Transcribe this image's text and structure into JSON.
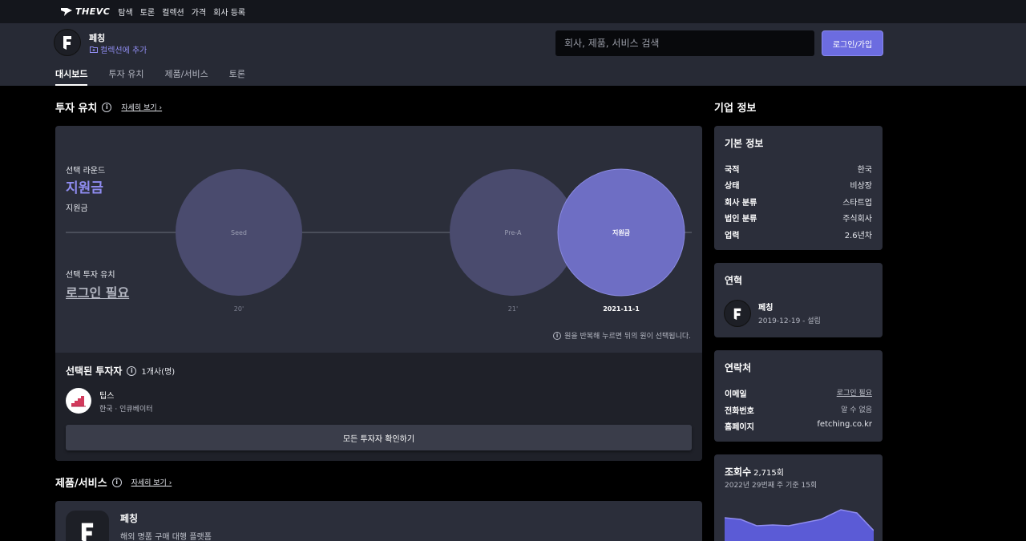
{
  "topnav": {
    "brand": "THEVC",
    "links": [
      "탐색",
      "토론",
      "컬렉션",
      "가격",
      "회사 등록"
    ]
  },
  "company": {
    "name": "페칭",
    "collection_label": "컬렉션에 추가",
    "search_placeholder": "회사, 제품, 서비스 검색",
    "login_label": "로그인/가입",
    "tabs": [
      "대시보드",
      "투자 유치",
      "제품/서비스",
      "토론"
    ],
    "active_tab": "대시보드"
  },
  "investment": {
    "title": "투자 유치",
    "more_label": "자세히 보기",
    "selected_round_label": "선택 라운드",
    "selected_round_name": "지원금",
    "selected_round_sub": "지원금",
    "selected_investment_label": "선택 투자 유치",
    "login_required": "로그인 필요",
    "hint": "원을 반복해 누르면 뒤의 원이 선택됩니다.",
    "rounds": [
      {
        "label": "Seed",
        "date": "20'",
        "selected": false
      },
      {
        "label": "Pre-A",
        "date": "21'",
        "selected": false
      },
      {
        "label": "지원금",
        "date": "2021-11-1",
        "selected": true
      }
    ],
    "selected_investors_title": "선택된 투자자",
    "selected_investors_count": "1개사(명)",
    "investors": [
      {
        "name": "팁스",
        "desc": "한국 · 인큐베이터"
      }
    ],
    "all_investors_button": "모든 투자자 확인하기"
  },
  "products": {
    "title": "제품/서비스",
    "more_label": "자세히 보기",
    "items": [
      {
        "name": "페칭",
        "desc": "해외 명품 구매 대행 플랫폼"
      }
    ]
  },
  "side": {
    "title": "기업 정보",
    "basic": {
      "title": "기본 정보",
      "rows": [
        {
          "k": "국적",
          "v": "한국"
        },
        {
          "k": "상태",
          "v": "비상장"
        },
        {
          "k": "회사 분류",
          "v": "스타트업"
        },
        {
          "k": "법인 분류",
          "v": "주식회사"
        },
        {
          "k": "업력",
          "v": "2.6년차"
        }
      ]
    },
    "history": {
      "title": "연혁",
      "name": "페칭",
      "date": "2019-12-19 - 설립"
    },
    "contact": {
      "title": "연락처",
      "rows": [
        {
          "k": "이메일",
          "v": "로그인 필요"
        },
        {
          "k": "전화번호",
          "v": "알 수 없음"
        },
        {
          "k": "홈페이지",
          "v": "fetching.co.kr"
        }
      ]
    },
    "views": {
      "title": "조회수",
      "total": "2,715회",
      "sub": "2022년 29번째 주 기준 15회"
    }
  },
  "colors": {
    "accent": "#6c6ce0",
    "accent_light": "#8f8cf0",
    "card": "#2b2e3a",
    "header": "#272a35"
  }
}
